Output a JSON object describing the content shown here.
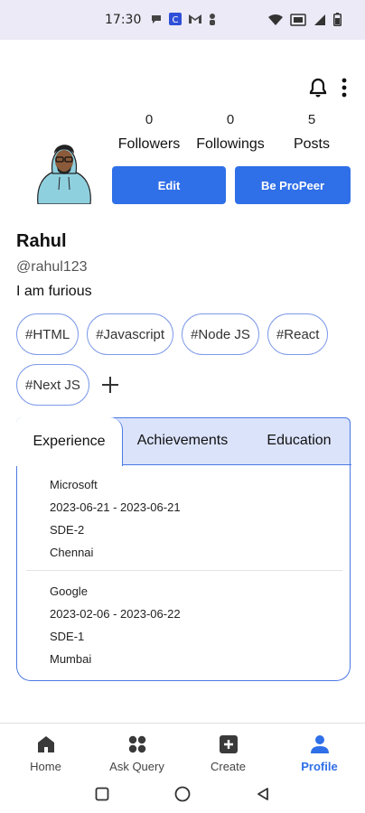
{
  "status_bar": {
    "time": "17:30"
  },
  "profile": {
    "stats": [
      {
        "value": "0",
        "label": "Followers"
      },
      {
        "value": "0",
        "label": "Followings"
      },
      {
        "value": "5",
        "label": "Posts"
      }
    ],
    "buttons": {
      "edit": "Edit",
      "propeer": "Be ProPeer"
    },
    "name": "Rahul",
    "handle": "@rahul123",
    "bio": "I am furious",
    "tags": [
      "#HTML",
      "#Javascript",
      "#Node JS",
      "#React",
      "#Next JS"
    ],
    "add_tag": "+"
  },
  "tabs": [
    "Experience",
    "Achievements",
    "Education"
  ],
  "experience": [
    {
      "company": "Microsoft",
      "dates": "2023-06-21 - 2023-06-21",
      "role": "SDE-2",
      "location": "Chennai"
    },
    {
      "company": "Google",
      "dates": "2023-02-06 - 2023-06-22",
      "role": "SDE-1",
      "location": "Mumbai"
    }
  ],
  "bottom_nav": [
    {
      "label": "Home",
      "icon": "home-icon"
    },
    {
      "label": "Ask Query",
      "icon": "grid-icon"
    },
    {
      "label": "Create",
      "icon": "plus-square-icon"
    },
    {
      "label": "Profile",
      "icon": "person-icon",
      "active": true
    }
  ],
  "colors": {
    "accent": "#2f6fe8",
    "tab_bg": "#dbe3fb",
    "tag_border": "#7e9ae8",
    "status_bg": "#eceaf6"
  }
}
